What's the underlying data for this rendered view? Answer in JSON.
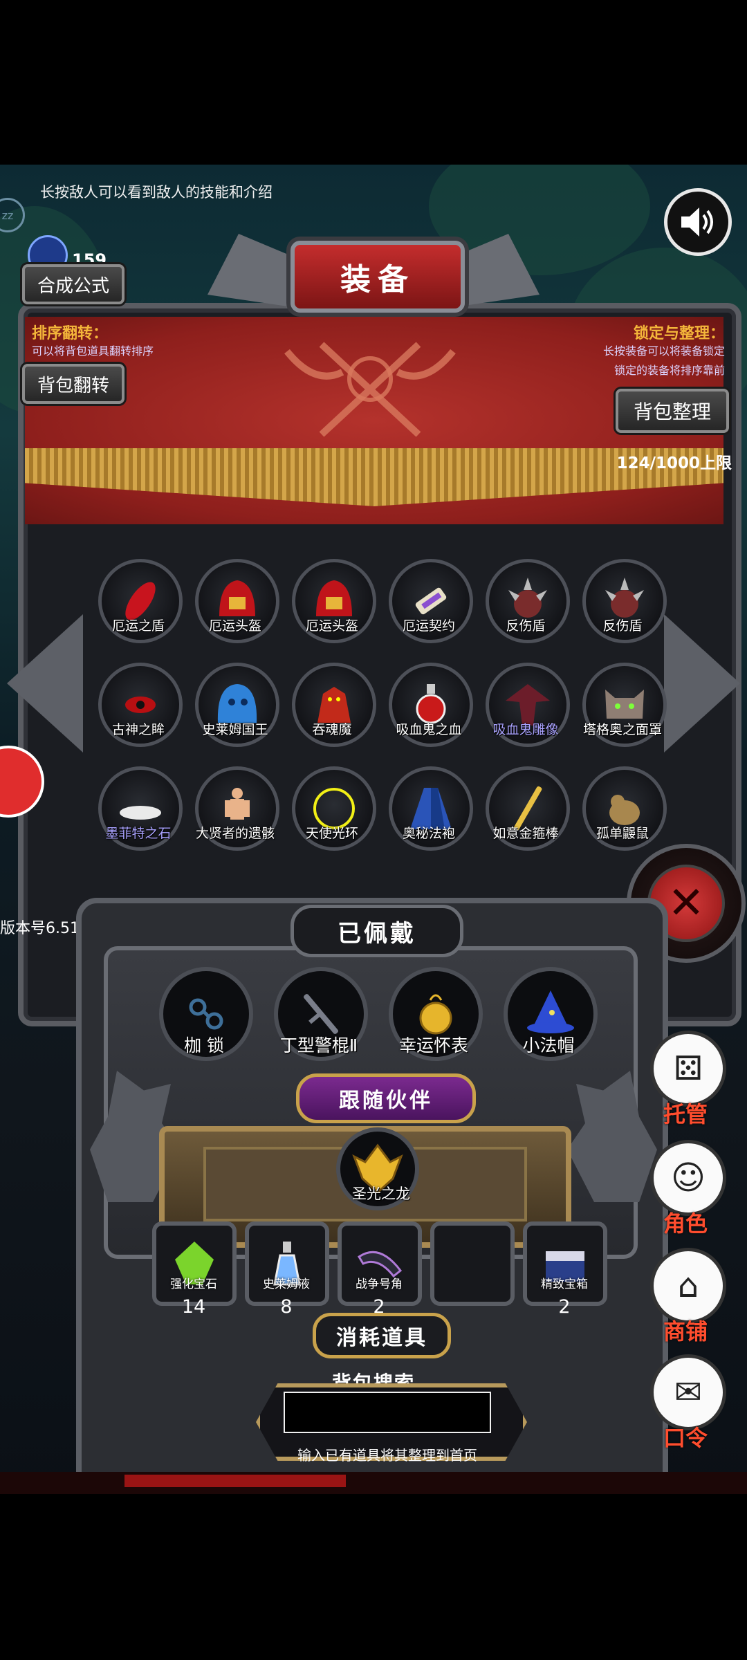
{
  "hint": "长按敌人可以看到敌人的技能和介绍",
  "zz_badge": "zz",
  "gem_count": "159",
  "buttons": {
    "synthesis": "合成公式",
    "bag_flip": "背包翻转",
    "bag_sort": "背包整理"
  },
  "title": "装备",
  "sort_section": {
    "label": "排序翻转：",
    "desc": "可以将背包道具翻转排序"
  },
  "lock_section": {
    "label": "锁定与整理：",
    "desc1": "长按装备可以将装备锁定",
    "desc2": "锁定的装备将排序靠前"
  },
  "capacity": "124/1000上限",
  "inventory": [
    {
      "label": "厄运之盾",
      "icon": "red-shield-icon"
    },
    {
      "label": "厄运头盔",
      "icon": "red-helmet-icon"
    },
    {
      "label": "厄运头盔",
      "icon": "red-helmet-icon"
    },
    {
      "label": "厄运契约",
      "icon": "scroll-icon"
    },
    {
      "label": "反伤盾",
      "icon": "spiked-shield-icon"
    },
    {
      "label": "反伤盾",
      "icon": "spiked-shield-icon"
    },
    {
      "label": "古神之眸",
      "icon": "eye-icon"
    },
    {
      "label": "史莱姆国王",
      "icon": "blue-slime-icon"
    },
    {
      "label": "吞魂魔",
      "icon": "red-demon-icon"
    },
    {
      "label": "吸血鬼之血",
      "icon": "blood-potion-icon"
    },
    {
      "label": "吸血鬼雕像",
      "icon": "vampire-statue-icon"
    },
    {
      "label": "塔格奥之面罩",
      "icon": "cat-mask-icon"
    },
    {
      "label": "墨菲特之石",
      "icon": "stone-icon"
    },
    {
      "label": "大贤者的遗骸",
      "icon": "remains-icon"
    },
    {
      "label": "天使光环",
      "icon": "halo-icon"
    },
    {
      "label": "奥秘法袍",
      "icon": "blue-robe-icon"
    },
    {
      "label": "如意金箍棒",
      "icon": "golden-staff-icon"
    },
    {
      "label": "孤单鼹鼠",
      "icon": "mole-icon"
    }
  ],
  "version": "版本号6.51",
  "equipped": {
    "title": "已佩戴",
    "items": [
      {
        "label": "枷 锁",
        "icon": "shackles-icon"
      },
      {
        "label": "丁型警棍Ⅱ",
        "icon": "baton-icon"
      },
      {
        "label": "幸运怀表",
        "icon": "pocket-watch-icon"
      },
      {
        "label": "小法帽",
        "icon": "wizard-hat-icon"
      }
    ]
  },
  "companion": {
    "title": "跟随伙伴",
    "item": {
      "label": "圣光之龙",
      "icon": "golden-dragon-icon"
    }
  },
  "consumables": {
    "title": "消耗道具",
    "items": [
      {
        "label": "强化宝石",
        "count": "14",
        "icon": "green-gem-icon"
      },
      {
        "label": "史莱姆液",
        "count": "8",
        "icon": "potion-icon"
      },
      {
        "label": "战争号角",
        "count": "2",
        "icon": "war-horn-icon"
      },
      {
        "label": "",
        "count": "",
        "icon": ""
      },
      {
        "label": "精致宝箱",
        "count": "2",
        "icon": "chest-icon"
      }
    ]
  },
  "search": {
    "title": "背包搜索",
    "value": "",
    "hint": "输入已有道具将其整理到首页"
  },
  "side_menu": [
    {
      "label": "托管",
      "icon": "dice-icon"
    },
    {
      "label": "角色",
      "icon": "hooded-figure-icon"
    },
    {
      "label": "商铺",
      "icon": "shop-icon"
    },
    {
      "label": "口令",
      "icon": "scroll-code-icon"
    }
  ],
  "colors": {
    "accent_gold": "#f4b63a",
    "banner_red": "#8e1f1c",
    "side_label": "#ff4d2e",
    "purple_text": "#a9a2ff"
  }
}
